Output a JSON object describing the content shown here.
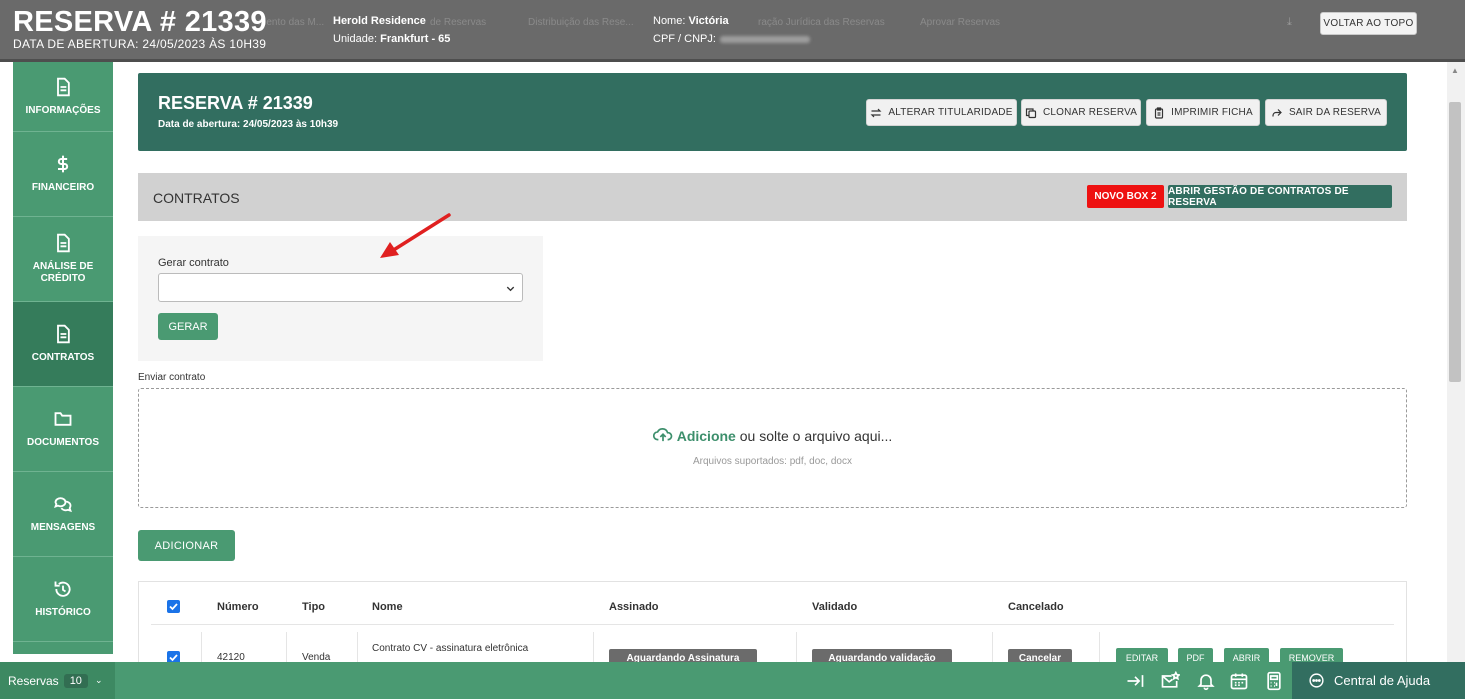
{
  "topbar": {
    "reserva_title": "RESERVA # 21339",
    "opening_date": "DATA DE ABERTURA: 24/05/2023 ÀS 10H39",
    "empreendimento": "Herold Residence",
    "unidade_label": "Unidade:",
    "unidade_value": "Frankfurt - 65",
    "nome_label": "Nome:",
    "nome_value": "Victória",
    "cpf_label": "CPF / CNPJ:",
    "ghost_items": [
      "mento das M...",
      "de Reservas",
      "Distribuição das Rese...",
      "ração Jurídica das Reservas",
      "Aprovar Reservas"
    ],
    "back_to_top": "VOLTAR AO TOPO"
  },
  "sidebar": {
    "items": [
      {
        "label": "INFORMAÇÕES",
        "icon": "document-icon"
      },
      {
        "label": "FINANCEIRO",
        "icon": "dollar-icon"
      },
      {
        "label": "ANÁLISE DE CRÉDITO",
        "icon": "document-icon"
      },
      {
        "label": "CONTRATOS",
        "icon": "document-icon",
        "active": true
      },
      {
        "label": "DOCUMENTOS",
        "icon": "folder-icon"
      },
      {
        "label": "MENSAGENS",
        "icon": "chat-icon"
      },
      {
        "label": "HISTÓRICO",
        "icon": "history-icon"
      }
    ]
  },
  "reserva_header": {
    "title": "RESERVA # 21339",
    "subtitle": "Data de abertura: 24/05/2023 às 10h39",
    "buttons": {
      "alterar": "ALTERAR TITULARIDADE",
      "clonar": "CLONAR RESERVA",
      "imprimir": "IMPRIMIR FICHA",
      "sair": "SAIR DA RESERVA"
    }
  },
  "contratos": {
    "title": "CONTRATOS",
    "novo_box": "NOVO BOX 2",
    "abrir_gestao": "ABRIR GESTÃO DE CONTRATOS DE RESERVA",
    "gerar_label": "Gerar contrato",
    "gerar_select_value": "",
    "gerar_button": "GERAR",
    "enviar_label": "Enviar contrato",
    "dropzone_add": "Adicione",
    "dropzone_text": " ou solte o arquivo aqui...",
    "dropzone_hint": "Arquivos suportados: pdf, doc, docx",
    "adicionar_button": "ADICIONAR"
  },
  "table": {
    "columns": [
      "Número",
      "Tipo",
      "Nome",
      "Assinado",
      "Validado",
      "Cancelado"
    ],
    "rows": [
      {
        "checked": true,
        "numero": "42120",
        "tipo": "Venda",
        "nome": "Contrato CV - assinatura eletrônica",
        "assinado": "Aguardando Assinatura",
        "validado": "Aguardando validação",
        "cancelado": "Cancelar",
        "actions": [
          "EDITAR",
          "PDF",
          "ABRIR",
          "REMOVER"
        ]
      }
    ]
  },
  "bottombar": {
    "reservas_label": "Reservas",
    "reservas_count": "10",
    "help_label": "Central de Ajuda"
  },
  "colors": {
    "dark_green": "#326e60",
    "green": "#4a9a72",
    "red_badge": "#ee1111",
    "annotation_arrow": "#e02020"
  }
}
